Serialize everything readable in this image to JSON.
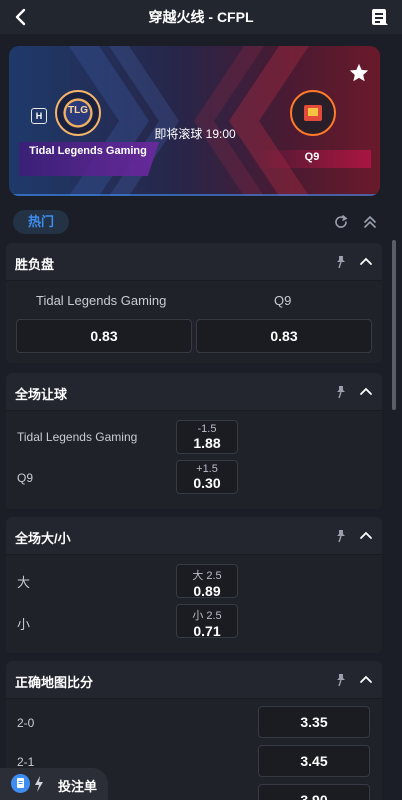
{
  "header": {
    "title": "穿越火线 - CFPL"
  },
  "match": {
    "home_badge": "H",
    "home_logo_text": "TLG",
    "home_name": "Tidal Legends Gaming",
    "away_name": "Q9",
    "status": "即将滚球 19:00"
  },
  "tabs": {
    "hot": "热门"
  },
  "markets": {
    "moneyline": {
      "title": "胜负盘",
      "home_name": "Tidal Legends Gaming",
      "away_name": "Q9",
      "home_odds": "0.83",
      "away_odds": "0.83"
    },
    "handicap": {
      "title": "全场让球",
      "rows": [
        {
          "team": "Tidal Legends Gaming",
          "line": "-1.5",
          "odds": "1.88"
        },
        {
          "team": "Q9",
          "line": "+1.5",
          "odds": "0.30"
        }
      ]
    },
    "total": {
      "title": "全场大/小",
      "rows": [
        {
          "label": "大",
          "line": "大 2.5",
          "odds": "0.89"
        },
        {
          "label": "小",
          "line": "小 2.5",
          "odds": "0.71"
        }
      ]
    },
    "correct_score": {
      "title": "正确地图比分",
      "rows": [
        {
          "score": "2-0",
          "odds": "3.35"
        },
        {
          "score": "2-1",
          "odds": "3.45"
        },
        {
          "score": "",
          "odds": "3.90"
        }
      ]
    }
  },
  "betslip": {
    "label": "投注单"
  }
}
